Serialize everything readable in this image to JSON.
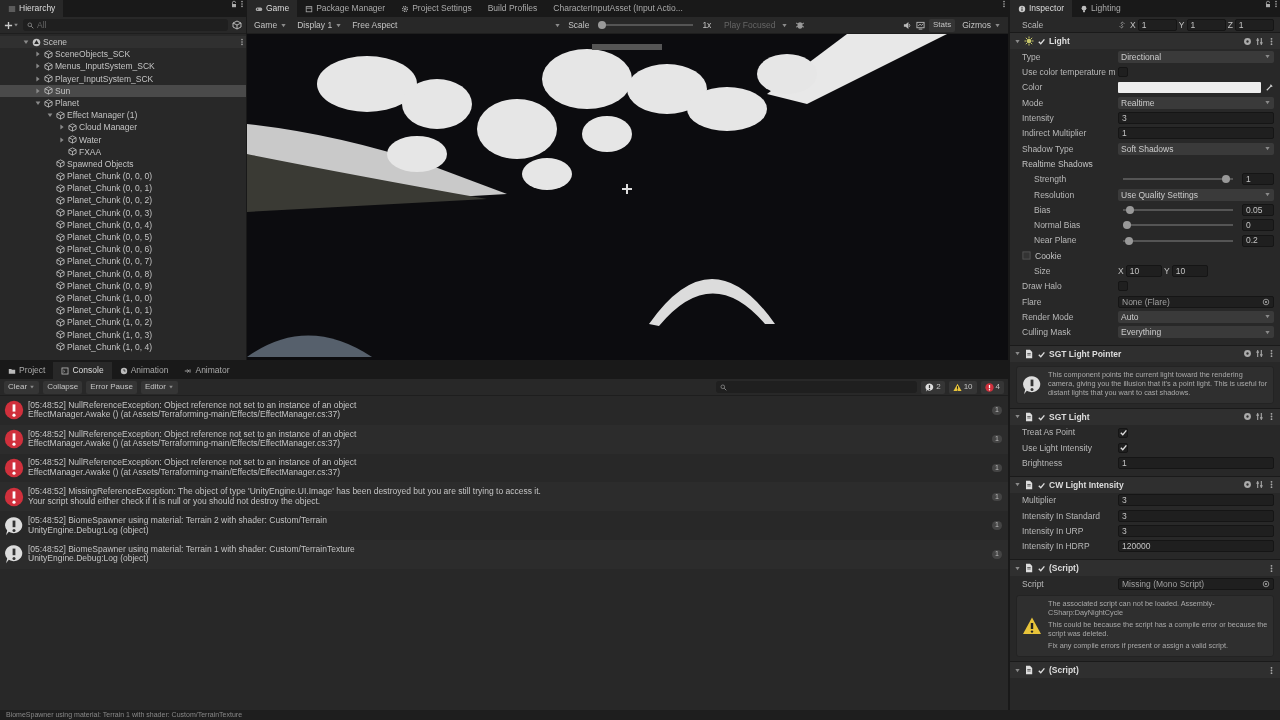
{
  "hierarchy": {
    "tab": "Hierarchy",
    "search": {
      "placeholder": "All"
    },
    "tree": [
      {
        "label": "Scene",
        "kind": "scene",
        "expanded": true,
        "selected": false,
        "children": [
          {
            "label": "SceneObjects_SCK",
            "kind": "object",
            "expanded": false,
            "selected": false
          },
          {
            "label": "Menus_InputSystem_SCK",
            "kind": "object",
            "expanded": false,
            "selected": false
          },
          {
            "label": "Player_InputSystem_SCK",
            "kind": "object",
            "expanded": false,
            "selected": false
          },
          {
            "label": "Sun",
            "kind": "object",
            "expanded": false,
            "selected": true
          },
          {
            "label": "Planet",
            "kind": "object",
            "expanded": true,
            "selected": false,
            "children": [
              {
                "label": "Effect Manager (1)",
                "kind": "object",
                "expanded": true,
                "selected": false,
                "children": [
                  {
                    "label": "Cloud Manager",
                    "kind": "object",
                    "expanded": false,
                    "selected": false
                  },
                  {
                    "label": "Water",
                    "kind": "object",
                    "expanded": false,
                    "selected": false
                  },
                  {
                    "label": "FXAA",
                    "kind": "object",
                    "selected": false
                  }
                ]
              },
              {
                "label": "Spawned Objects",
                "kind": "object",
                "selected": false
              },
              {
                "label": "Planet_Chunk (0, 0, 0)",
                "kind": "object",
                "selected": false
              },
              {
                "label": "Planet_Chunk (0, 0, 1)",
                "kind": "object",
                "selected": false
              },
              {
                "label": "Planet_Chunk (0, 0, 2)",
                "kind": "object",
                "selected": false
              },
              {
                "label": "Planet_Chunk (0, 0, 3)",
                "kind": "object",
                "selected": false
              },
              {
                "label": "Planet_Chunk (0, 0, 4)",
                "kind": "object",
                "selected": false
              },
              {
                "label": "Planet_Chunk (0, 0, 5)",
                "kind": "object",
                "selected": false
              },
              {
                "label": "Planet_Chunk (0, 0, 6)",
                "kind": "object",
                "selected": false
              },
              {
                "label": "Planet_Chunk (0, 0, 7)",
                "kind": "object",
                "selected": false
              },
              {
                "label": "Planet_Chunk (0, 0, 8)",
                "kind": "object",
                "selected": false
              },
              {
                "label": "Planet_Chunk (0, 0, 9)",
                "kind": "object",
                "selected": false
              },
              {
                "label": "Planet_Chunk (1, 0, 0)",
                "kind": "object",
                "selected": false
              },
              {
                "label": "Planet_Chunk (1, 0, 1)",
                "kind": "object",
                "selected": false
              },
              {
                "label": "Planet_Chunk (1, 0, 2)",
                "kind": "object",
                "selected": false
              },
              {
                "label": "Planet_Chunk (1, 0, 3)",
                "kind": "object",
                "selected": false
              },
              {
                "label": "Planet_Chunk (1, 0, 4)",
                "kind": "object",
                "selected": false
              }
            ]
          }
        ]
      }
    ]
  },
  "game": {
    "tabs": [
      {
        "label": "Game",
        "kind": "game",
        "selected": true
      },
      {
        "label": "Package Manager",
        "kind": "package",
        "selected": false
      },
      {
        "label": "Project Settings",
        "kind": "settings",
        "selected": false
      },
      {
        "label": "Build Profiles",
        "kind": "plain",
        "selected": false
      },
      {
        "label": "CharacterInputAsset (Input Actio...",
        "kind": "plain",
        "selected": false
      }
    ],
    "toolbar": {
      "view_menu": "Game",
      "display": "Display 1",
      "aspect": "Free Aspect",
      "scale_label": "Scale",
      "scale": {
        "level": 0,
        "reading": "1x"
      },
      "play_mode": "Play Focused",
      "stats": "Stats",
      "gizmos": "Gizmos"
    }
  },
  "console": {
    "tabs": [
      {
        "label": "Project",
        "kind": "project",
        "selected": false
      },
      {
        "label": "Console",
        "kind": "console",
        "selected": true
      },
      {
        "label": "Animation",
        "kind": "animation",
        "selected": false
      },
      {
        "label": "Animator",
        "kind": "animator",
        "selected": false
      }
    ],
    "toolbar": {
      "clear": "Clear",
      "collapse": "Collapse",
      "error_pause": "Error Pause",
      "editor": "Editor",
      "counts": [
        {
          "kind": "info",
          "count": "2"
        },
        {
          "kind": "warning",
          "count": "10"
        },
        {
          "kind": "error",
          "count": "4"
        }
      ]
    },
    "messages": [
      {
        "kind": "error",
        "line1": "[05:48:52] NullReferenceException: Object reference not set to an instance of an object",
        "line2": "EffectManager.Awake () (at Assets/Terraforming-main/Effects/EffectManager.cs:37)",
        "count": "1"
      },
      {
        "kind": "error",
        "line1": "[05:48:52] NullReferenceException: Object reference not set to an instance of an object",
        "line2": "EffectManager.Awake () (at Assets/Terraforming-main/Effects/EffectManager.cs:37)",
        "count": "1"
      },
      {
        "kind": "error",
        "line1": "[05:48:52] NullReferenceException: Object reference not set to an instance of an object",
        "line2": "EffectManager.Awake () (at Assets/Terraforming-main/Effects/EffectManager.cs:37)",
        "count": "1"
      },
      {
        "kind": "error",
        "line1": "[05:48:52] MissingReferenceException: The object of type 'UnityEngine.UI.Image' has been destroyed but you are still trying to access it.",
        "line2": "Your script should either check if it is null or you should not destroy the object.",
        "count": "1"
      },
      {
        "kind": "info",
        "line1": "[05:48:52] BiomeSpawner using material: Terrain 2 with shader: Custom/Terrain",
        "line2": "UnityEngine.Debug:Log (object)",
        "count": "1"
      },
      {
        "kind": "info",
        "line1": "[05:48:52] BiomeSpawner using material: Terrain 1 with shader: Custom/TerrainTexture",
        "line2": "UnityEngine.Debug:Log (object)",
        "count": "1"
      }
    ]
  },
  "inspector": {
    "tabs": [
      {
        "label": "Inspector",
        "kind": "inspector",
        "selected": true
      },
      {
        "label": "Lighting",
        "kind": "lighting",
        "selected": false
      }
    ],
    "scale": {
      "label": "Scale",
      "axes": [
        {
          "axis": "X",
          "value": "1"
        },
        {
          "axis": "Y",
          "value": "1"
        },
        {
          "axis": "Z",
          "value": "1"
        }
      ]
    },
    "components": [
      {
        "title": "Light",
        "kind": "light",
        "enabled": true,
        "props": [
          {
            "kind": "dropdown",
            "label": "Type",
            "value": "Directional"
          },
          {
            "kind": "checkbox",
            "label": "Use color temperature m",
            "checked": false
          },
          {
            "kind": "color",
            "label": "Color",
            "color": "#eeeeee"
          },
          {
            "kind": "dropdown",
            "label": "Mode",
            "value": "Realtime"
          },
          {
            "kind": "number",
            "label": "Intensity",
            "value": "3"
          },
          {
            "kind": "number",
            "label": "Indirect Multiplier",
            "value": "1"
          },
          {
            "kind": "dropdown",
            "label": "Shadow Type",
            "value": "Soft Shadows"
          },
          {
            "kind": "group",
            "label": "Realtime Shadows",
            "children": [
              {
                "kind": "slider",
                "label": "Strength",
                "level": 0.97,
                "value": "1"
              },
              {
                "kind": "dropdown",
                "label": "Resolution",
                "value": "Use Quality Settings"
              },
              {
                "kind": "slider",
                "label": "Bias",
                "level": 0.03,
                "value": "0.05"
              },
              {
                "kind": "slider",
                "label": "Normal Bias",
                "level": 0,
                "value": "0"
              },
              {
                "kind": "slider",
                "label": "Near Plane",
                "level": 0.02,
                "value": "0.2"
              }
            ]
          },
          {
            "kind": "texture",
            "label": "Cookie",
            "children": [
              {
                "kind": "vector2",
                "label": "Size",
                "axes": [
                  {
                    "axis": "X",
                    "value": "10"
                  },
                  {
                    "axis": "Y",
                    "value": "10"
                  }
                ]
              }
            ]
          },
          {
            "kind": "checkbox",
            "label": "Draw Halo",
            "checked": false
          },
          {
            "kind": "object",
            "label": "Flare",
            "value": "None (Flare)"
          },
          {
            "kind": "dropdown",
            "label": "Render Mode",
            "value": "Auto"
          },
          {
            "kind": "dropdown",
            "label": "Culling Mask",
            "value": "Everything"
          }
        ]
      },
      {
        "title": "SGT Light Pointer",
        "kind": "component",
        "enabled": true,
        "help": {
          "kind": "info",
          "texts": [
            "This component points the current light toward the rendering camera, giving you the illusion that it's a point light. This is useful for distant lights that you want to cast shadows."
          ]
        }
      },
      {
        "title": "SGT Light",
        "kind": "component",
        "enabled": true,
        "props": [
          {
            "kind": "checkbox",
            "label": "Treat As Point",
            "checked": true
          },
          {
            "kind": "checkbox",
            "label": "Use Light Intensity",
            "checked": true
          },
          {
            "kind": "number",
            "label": "Brightness",
            "value": "1"
          }
        ]
      },
      {
        "title": "CW Light Intensity",
        "kind": "component",
        "enabled": true,
        "props": [
          {
            "kind": "number",
            "label": "Multiplier",
            "value": "3"
          },
          {
            "kind": "number",
            "label": "Intensity In Standard",
            "value": "3"
          },
          {
            "kind": "number",
            "label": "Intensity In URP",
            "value": "3"
          },
          {
            "kind": "number",
            "label": "Intensity In HDRP",
            "value": "120000"
          }
        ]
      },
      {
        "title": "(Script)",
        "kind": "script",
        "enabled": true,
        "props": [
          {
            "kind": "object",
            "label": "Script",
            "value": "Missing (Mono Script)"
          }
        ],
        "help": {
          "kind": "warning",
          "texts": [
            "The associated script can not be loaded. Assembly-CSharp:DayNightCycle",
            "This could be because the script has a compile error or because the script was deleted.",
            "Fix any compile errors if present or assign a valid script."
          ]
        }
      },
      {
        "title": "(Script)",
        "kind": "script",
        "enabled": true
      }
    ]
  },
  "status_bar": {
    "text": "BiomeSpawner using material: Terrain 1 with shader: Custom/TerrainTexture"
  }
}
